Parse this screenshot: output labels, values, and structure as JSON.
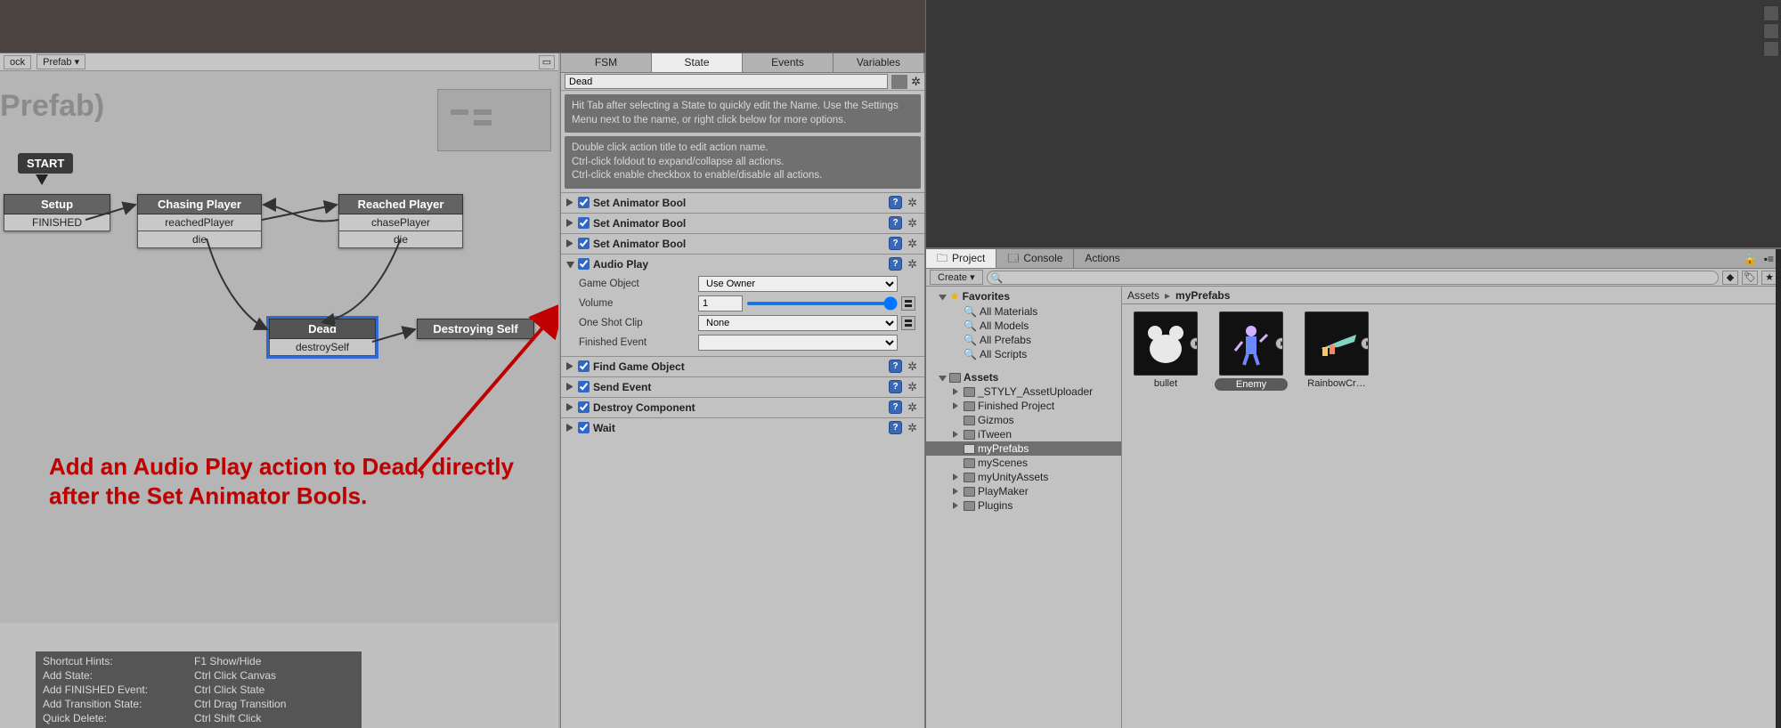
{
  "viewport": {},
  "graph": {
    "toolbar": {
      "lock_label": "ock",
      "prefab_label": "Prefab ▾"
    },
    "title": "Prefab)",
    "start_label": "START",
    "nodes": {
      "setup": {
        "title": "Setup",
        "rows": [
          "FINISHED"
        ]
      },
      "chasing": {
        "title": "Chasing Player",
        "rows": [
          "reachedPlayer",
          "die"
        ]
      },
      "reached": {
        "title": "Reached Player",
        "rows": [
          "chasePlayer",
          "die"
        ]
      },
      "dead": {
        "title": "Dead",
        "rows": [
          "destroySelf"
        ]
      },
      "destroy": {
        "title": "Destroying Self",
        "rows": []
      }
    },
    "hints": [
      [
        "Shortcut Hints:",
        "F1 Show/Hide"
      ],
      [
        "Add State:",
        "Ctrl Click Canvas"
      ],
      [
        "Add FINISHED Event:",
        "Ctrl Click State"
      ],
      [
        "Add Transition State:",
        "Ctrl Drag Transition"
      ],
      [
        "Quick Delete:",
        "Ctrl Shift Click"
      ]
    ],
    "annotation": "Add an Audio Play action to Dead, directly after the Set Animator Bools."
  },
  "inspector": {
    "tabs": [
      "FSM",
      "State",
      "Events",
      "Variables"
    ],
    "active_tab": "State",
    "state_name": "Dead",
    "hint1": "Hit Tab after selecting a State to quickly edit the Name. Use the Settings Menu next to the name, or right click below for more options.",
    "hint2": "Double click action title to edit action name.\nCtrl-click foldout to expand/collapse all actions.\nCtrl-click enable checkbox to enable/disable all actions.",
    "actions": [
      {
        "title": "Set Animator Bool",
        "open": false
      },
      {
        "title": "Set Animator Bool",
        "open": false
      },
      {
        "title": "Set Animator Bool",
        "open": false
      },
      {
        "title": "Audio Play",
        "open": true,
        "fields": {
          "game_object_label": "Game Object",
          "game_object_value": "Use Owner",
          "volume_label": "Volume",
          "volume_value": "1",
          "one_shot_label": "One Shot Clip",
          "one_shot_value": "None",
          "finished_label": "Finished Event",
          "finished_value": ""
        }
      },
      {
        "title": "Find Game Object",
        "open": false
      },
      {
        "title": "Send Event",
        "open": false
      },
      {
        "title": "Destroy Component",
        "open": false
      },
      {
        "title": "Wait",
        "open": false
      }
    ]
  },
  "project": {
    "tabs": [
      {
        "label": "Project",
        "icon": "folder"
      },
      {
        "label": "Console",
        "icon": "console"
      },
      {
        "label": "Actions",
        "icon": ""
      }
    ],
    "active_tab": "Project",
    "create_label": "Create ▾",
    "search_placeholder": "",
    "favorites_label": "Favorites",
    "favorites": [
      "All Materials",
      "All Models",
      "All Prefabs",
      "All Scripts"
    ],
    "assets_label": "Assets",
    "assets_tree": [
      {
        "label": "_STYLY_AssetUploader",
        "expandable": true
      },
      {
        "label": "Finished Project",
        "expandable": true
      },
      {
        "label": "Gizmos",
        "expandable": false
      },
      {
        "label": "iTween",
        "expandable": true
      },
      {
        "label": "myPrefabs",
        "expandable": false,
        "selected": true
      },
      {
        "label": "myScenes",
        "expandable": false
      },
      {
        "label": "myUnityAssets",
        "expandable": true
      },
      {
        "label": "PlayMaker",
        "expandable": true
      },
      {
        "label": "Plugins",
        "expandable": true
      }
    ],
    "crumb_root": "Assets",
    "crumb_leaf": "myPrefabs",
    "thumbs": [
      {
        "label": "bullet",
        "selected": false,
        "art": "teddy"
      },
      {
        "label": "Enemy",
        "selected": true,
        "art": "figure"
      },
      {
        "label": "RainbowCr…",
        "selected": false,
        "art": "trumpet"
      }
    ]
  }
}
